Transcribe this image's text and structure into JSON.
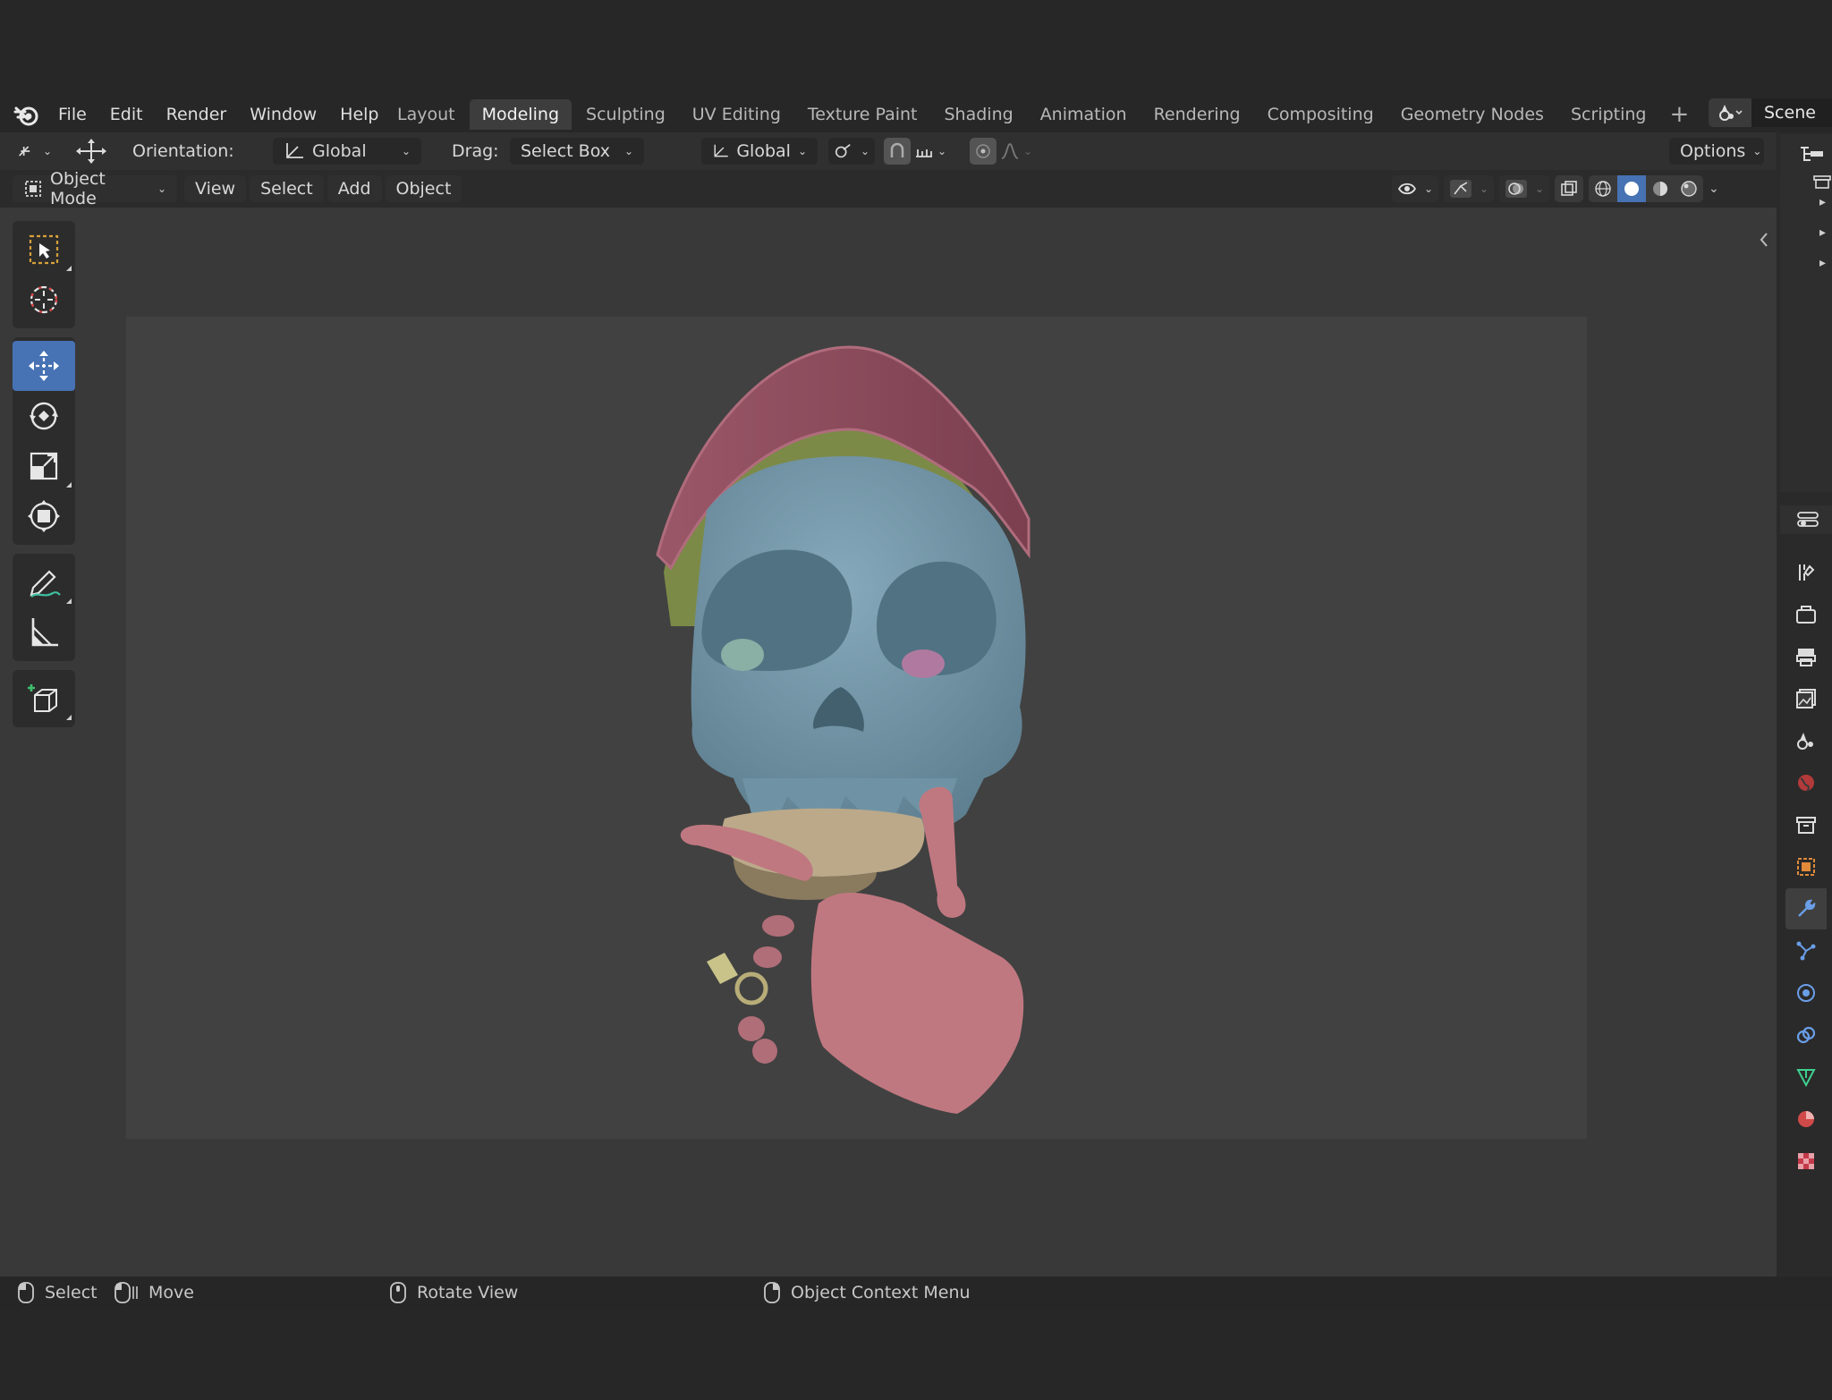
{
  "menus": [
    "File",
    "Edit",
    "Render",
    "Window",
    "Help"
  ],
  "workspace_tabs": [
    "Layout",
    "Modeling",
    "Sculpting",
    "UV Editing",
    "Texture Paint",
    "Shading",
    "Animation",
    "Rendering",
    "Compositing",
    "Geometry Nodes",
    "Scripting"
  ],
  "active_tab": "Modeling",
  "scene": {
    "label": "Scene"
  },
  "tool_header": {
    "orientation_label": "Orientation:",
    "orientation_value": "Global",
    "drag_label": "Drag:",
    "drag_value": "Select Box",
    "transform_orientation": "Global",
    "options_label": "Options"
  },
  "view_header": {
    "mode": "Object Mode",
    "menus": [
      "View",
      "Select",
      "Add",
      "Object"
    ]
  },
  "toolbar_tools": [
    "select-box-icon",
    "cursor-icon",
    "move-icon",
    "rotate-icon",
    "scale-icon",
    "transform-icon",
    "annotate-icon",
    "measure-icon",
    "add-cube-icon"
  ],
  "active_tool": "move-icon",
  "status_bar": {
    "select": "Select",
    "move": "Move",
    "rotate_view": "Rotate View",
    "context_menu": "Object Context Menu"
  },
  "colors": {
    "accent": "#4772b3",
    "skull": "#6f93a5",
    "cap": "#8a4a5b",
    "bones": "#c07880"
  }
}
